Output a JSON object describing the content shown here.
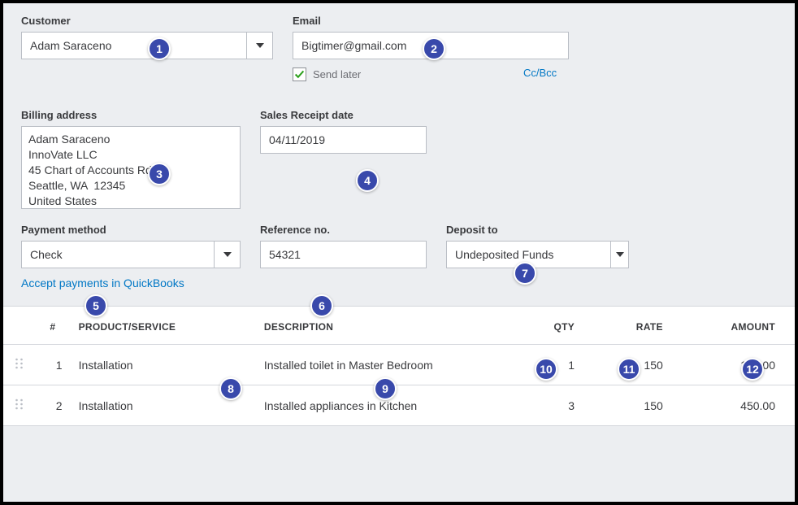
{
  "customer": {
    "label": "Customer",
    "value": "Adam Saraceno"
  },
  "email": {
    "label": "Email",
    "value": "Bigtimer@gmail.com"
  },
  "send_later": {
    "label": "Send later",
    "checked": true
  },
  "ccbcc": "Cc/Bcc",
  "billing_address": {
    "label": "Billing address",
    "value": "Adam Saraceno\nInnoVate LLC\n45 Chart of Accounts Rd.\nSeattle, WA  12345\nUnited States"
  },
  "receipt_date": {
    "label": "Sales Receipt date",
    "value": "04/11/2019"
  },
  "payment_method": {
    "label": "Payment method",
    "value": "Check"
  },
  "reference_no": {
    "label": "Reference no.",
    "value": "54321"
  },
  "deposit_to": {
    "label": "Deposit to",
    "value": "Undeposited Funds"
  },
  "accept_payments_link": "Accept payments in QuickBooks",
  "columns": {
    "num": "#",
    "product": "PRODUCT/SERVICE",
    "description": "DESCRIPTION",
    "qty": "QTY",
    "rate": "RATE",
    "amount": "AMOUNT"
  },
  "lines": [
    {
      "num": "1",
      "product": "Installation",
      "description": "Installed toilet in Master Bedroom",
      "qty": "1",
      "rate": "150",
      "amount": "150.00"
    },
    {
      "num": "2",
      "product": "Installation",
      "description": "Installed appliances in Kitchen",
      "qty": "3",
      "rate": "150",
      "amount": "450.00"
    }
  ],
  "badges": [
    "1",
    "2",
    "3",
    "4",
    "5",
    "6",
    "7",
    "8",
    "9",
    "10",
    "11",
    "12"
  ]
}
